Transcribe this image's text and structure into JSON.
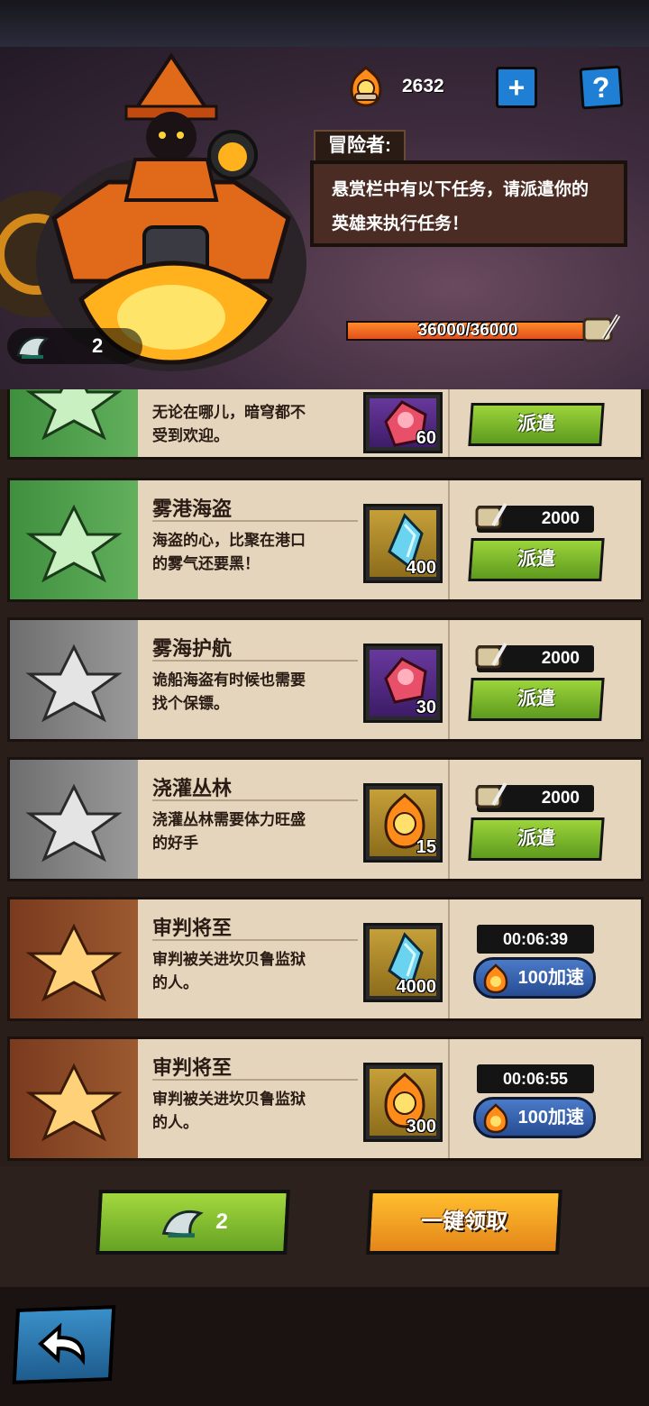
{
  "header": {
    "resource_icon": "fire-badge-icon",
    "resource_value": "2632",
    "plus_label": "+",
    "help_label": "?"
  },
  "dialog": {
    "speaker": "冒险者:",
    "text_line1": "悬赏栏中有以下任务，请派遣你的",
    "text_line2": "英雄来执行任务！"
  },
  "progress": {
    "text": "36000/36000",
    "fraction": 1.0,
    "fill_color": "#e0501c"
  },
  "hero_count": {
    "icon": "winged-boot-icon",
    "value": "2"
  },
  "quests": [
    {
      "title": "",
      "desc": "无论在哪儿，暗穹都不受到欢迎。",
      "desc_line1": "无论在哪儿，暗穹都不",
      "desc_line2": "受到欢迎。",
      "tier": "green",
      "reward_icon": "red-crystal-icon",
      "reward_bg": "purple",
      "reward_qty": "60",
      "cost": "",
      "action": "派遣",
      "timer": ""
    },
    {
      "title": "雾港海盗",
      "desc_line1": "海盗的心，比聚在港口",
      "desc_line2": "的雾气还要黑！",
      "tier": "green",
      "reward_icon": "blue-crystal-icon",
      "reward_bg": "gold",
      "reward_qty": "400",
      "cost": "2000",
      "action": "派遣",
      "timer": ""
    },
    {
      "title": "雾海护航",
      "desc_line1": "诡船海盗有时候也需要",
      "desc_line2": "找个保镖。",
      "tier": "gray",
      "reward_icon": "red-crystal-icon",
      "reward_bg": "purple",
      "reward_qty": "30",
      "cost": "2000",
      "action": "派遣",
      "timer": ""
    },
    {
      "title": "浇灌丛林",
      "desc_line1": "浇灌丛林需要体力旺盛",
      "desc_line2": "的好手",
      "tier": "gray",
      "reward_icon": "fire-badge-icon",
      "reward_bg": "gold",
      "reward_qty": "15",
      "cost": "2000",
      "action": "派遣",
      "timer": ""
    },
    {
      "title": "审判将至",
      "desc_line1": "审判被关进坎贝鲁监狱",
      "desc_line2": "的人。",
      "tier": "brown",
      "reward_icon": "blue-crystal-icon",
      "reward_bg": "gold",
      "reward_qty": "4000",
      "cost": "",
      "action": "100加速",
      "timer": "00:06:39"
    },
    {
      "title": "审判将至",
      "desc_line1": "审判被关进坎贝鲁监狱",
      "desc_line2": "的人。",
      "tier": "brown",
      "reward_icon": "fire-badge-icon",
      "reward_bg": "gold",
      "reward_qty": "300",
      "cost": "",
      "action": "100加速",
      "timer": "00:06:55"
    }
  ],
  "bottom": {
    "hero_button_value": "2",
    "claim_all_label": "一键领取",
    "back_icon": "back-arrow-icon"
  },
  "colors": {
    "accent_green": "#7ec030",
    "accent_orange": "#f0a020",
    "accent_blue": "#1f7fd4"
  }
}
